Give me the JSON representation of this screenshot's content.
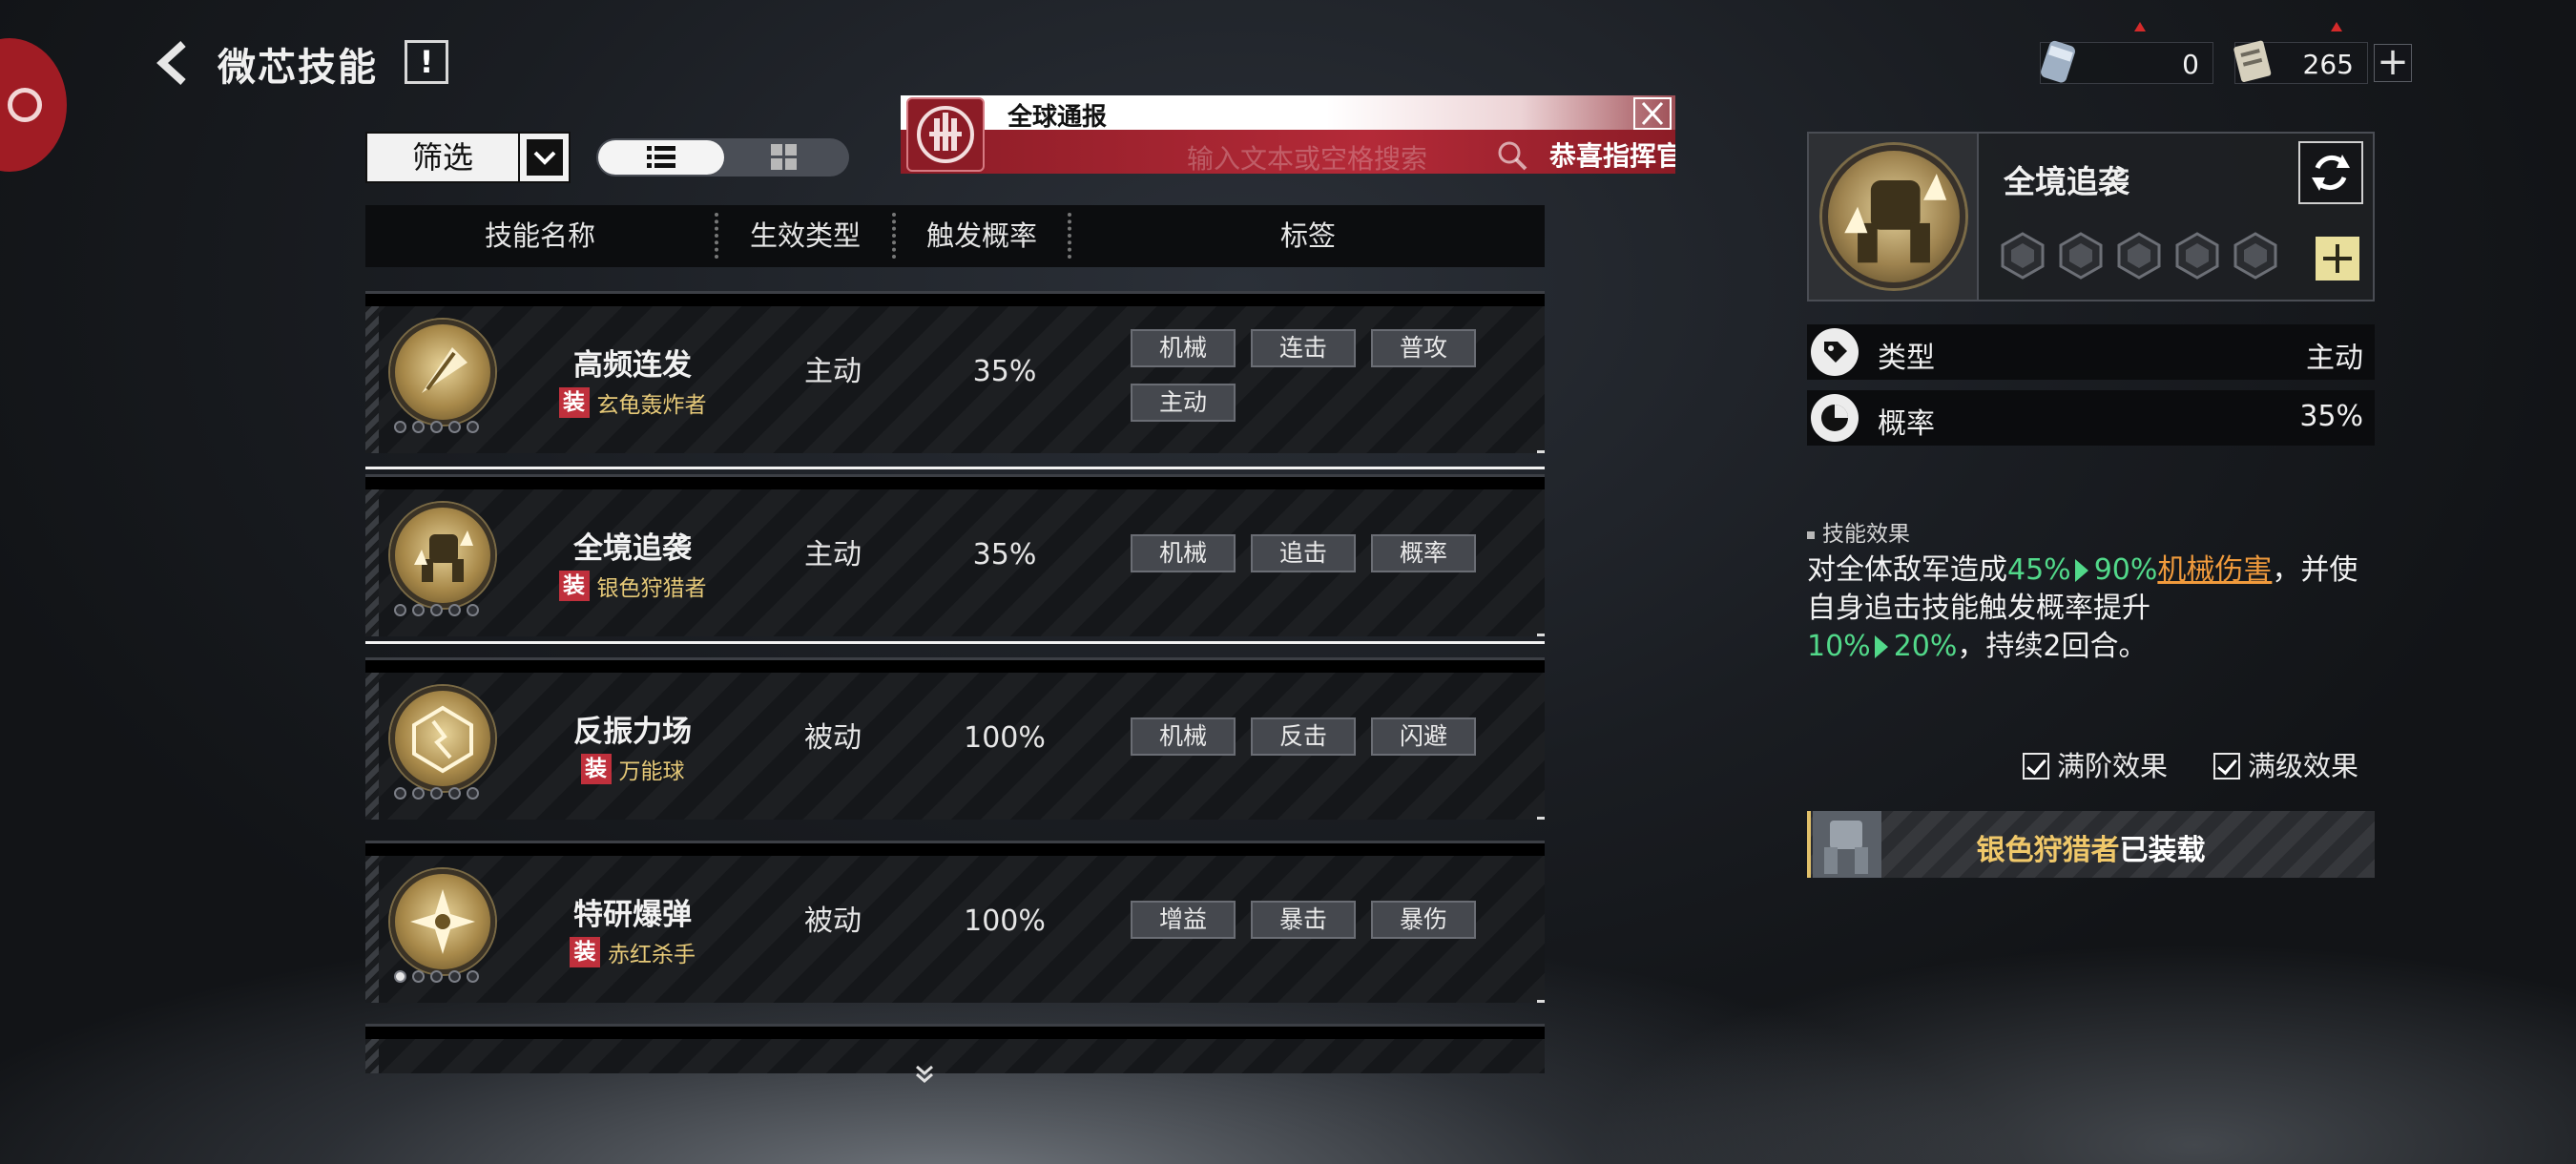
{
  "header": {
    "title": "微芯技能",
    "info_label": "!",
    "currency": [
      {
        "icon": "canister-icon",
        "value": "0"
      },
      {
        "icon": "chip-card-icon",
        "value": "265"
      }
    ],
    "plus_label": "+"
  },
  "filter": {
    "label": "筛选",
    "view_mode": "list"
  },
  "broadcast": {
    "title": "全球通报",
    "ghost_text": "输入文本或空格搜索",
    "message": "恭喜指挥官"
  },
  "table": {
    "headers": [
      "技能名称",
      "生效类型",
      "触发概率",
      "标签"
    ],
    "equip_badge": "装",
    "rows": [
      {
        "name": "高频连发",
        "owner": "玄龟轰炸者",
        "type": "主动",
        "rate": "35%",
        "tags": [
          "机械",
          "连击",
          "普攻",
          "主动"
        ],
        "stars_on": 0,
        "icon": "bullet-icon",
        "selected": false
      },
      {
        "name": "全境追袭",
        "owner": "银色狩猎者",
        "type": "主动",
        "rate": "35%",
        "tags": [
          "机械",
          "追击",
          "概率"
        ],
        "stars_on": 0,
        "icon": "mech-icon",
        "selected": true
      },
      {
        "name": "反振力场",
        "owner": "万能球",
        "type": "被动",
        "rate": "100%",
        "tags": [
          "机械",
          "反击",
          "闪避"
        ],
        "stars_on": 0,
        "icon": "force-field-icon",
        "selected": false
      },
      {
        "name": "特研爆弹",
        "owner": "赤红杀手",
        "type": "被动",
        "rate": "100%",
        "tags": [
          "增益",
          "暴击",
          "暴伤"
        ],
        "stars_on": 1,
        "icon": "bomb-icon",
        "selected": false
      }
    ]
  },
  "detail": {
    "name": "全境追袭",
    "attributes": [
      {
        "key": "类型",
        "value": "主动",
        "icon": "tag-icon"
      },
      {
        "key": "概率",
        "value": "35%",
        "icon": "probability-icon"
      }
    ],
    "effect_heading": "技能效果",
    "effect": {
      "p1": "对全体敌军造成",
      "from1": "45%",
      "to1": "90%",
      "dmg": "机械伤害",
      "p2": "，并使自身追击技能触发概率提升",
      "from2": "10%",
      "to2": "20%",
      "p3": "，持续2回合。"
    },
    "checks": {
      "full_tier": "满阶效果",
      "full_level": "满级效果"
    },
    "equipped": {
      "owner": "银色狩猎者",
      "suffix": "已装载"
    }
  }
}
